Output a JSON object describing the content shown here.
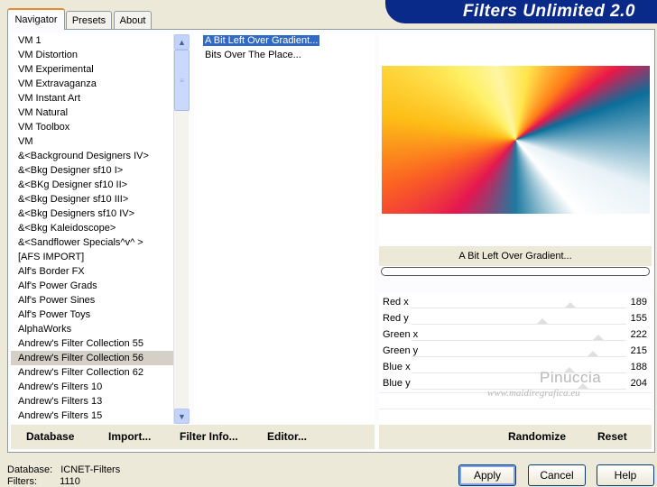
{
  "tabs": [
    {
      "label": "Navigator",
      "active": true
    },
    {
      "label": "Presets",
      "active": false
    },
    {
      "label": "About",
      "active": false
    }
  ],
  "banner_title": "Filters Unlimited 2.0",
  "categories": [
    "VM 1",
    "VM Distortion",
    "VM Experimental",
    "VM Extravaganza",
    "VM Instant Art",
    "VM Natural",
    "VM Toolbox",
    "VM",
    "&<Background Designers IV>",
    "&<Bkg Designer sf10 I>",
    "&<BKg Designer sf10 II>",
    "&<Bkg Designer sf10 III>",
    "&<Bkg Designers sf10 IV>",
    "&<Bkg Kaleidoscope>",
    "&<Sandflower Specials^v^ >",
    "[AFS IMPORT]",
    "Alf's Border FX",
    "Alf's Power Grads",
    "Alf's Power Sines",
    "Alf's Power Toys",
    "AlphaWorks",
    "Andrew's Filter Collection 55",
    "Andrew's Filter Collection 56",
    "Andrew's Filter Collection 62",
    "Andrew's Filters 10",
    "Andrew's Filters 13",
    "Andrew's Filters 15"
  ],
  "selected_category": "Andrew's Filter Collection 56",
  "filters": [
    "A Bit Left Over Gradient...",
    "Bits Over The Place..."
  ],
  "selected_filter": "A Bit Left Over Gradient...",
  "preview_filter_name": "A Bit Left Over Gradient...",
  "params": [
    {
      "label": "Red x",
      "value": "189",
      "level": 189
    },
    {
      "label": "Red y",
      "value": "155",
      "level": 155
    },
    {
      "label": "Green x",
      "value": "222",
      "level": 222
    },
    {
      "label": "Green y",
      "value": "215",
      "level": 215
    },
    {
      "label": "Blue x",
      "value": "188",
      "level": 188
    },
    {
      "label": "Blue y",
      "value": "204",
      "level": 204
    }
  ],
  "watermark": {
    "name": "Pinuccia",
    "site": "www.maidiregrafica.eu"
  },
  "bottom_buttons": {
    "database": "Database",
    "import": "Import...",
    "filter_info": "Filter Info...",
    "editor": "Editor...",
    "randomize": "Randomize",
    "reset": "Reset"
  },
  "status": {
    "database_label": "Database:",
    "database_value": "ICNET-Filters",
    "filters_label": "Filters:",
    "filters_value": "1110"
  },
  "dialog_buttons": {
    "apply": "Apply",
    "cancel": "Cancel",
    "help": "Help"
  },
  "colors": {
    "selection": "#316ac5",
    "banner": "#0a2a8a"
  }
}
